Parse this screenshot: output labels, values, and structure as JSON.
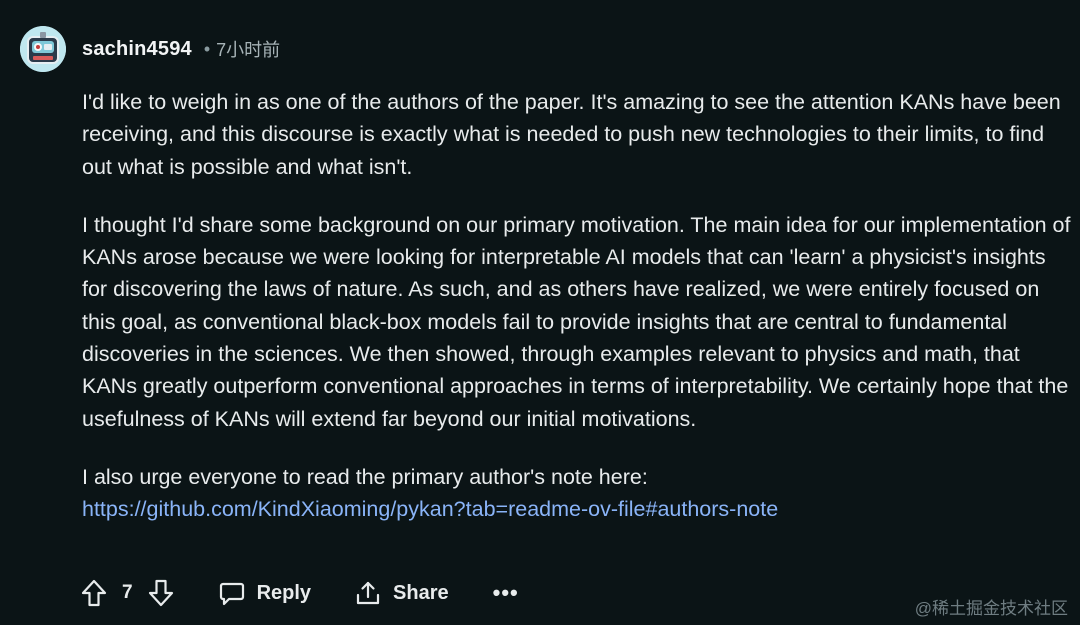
{
  "comment": {
    "username": "sachin4594",
    "dot": "•",
    "timestamp": "7小时前",
    "paragraphs": [
      "I'd like to weigh in as one of the authors of the paper. It's amazing to see the attention KANs have been receiving, and this discourse is exactly what is needed to push new technologies to their limits, to find out what is possible and what isn't.",
      "I thought I'd share some background on our primary motivation. The main idea for our implementation of KANs arose because we were looking for interpretable AI models that can 'learn' a physicist's insights for discovering the laws of nature. As such, and as others have realized, we were entirely focused on this goal, as conventional black-box models fail to provide insights that are central to fundamental discoveries in the sciences. We then showed, through examples relevant to physics and math, that KANs greatly outperform conventional approaches in terms of interpretability. We certainly hope that the usefulness of KANs will extend far beyond our initial motivations.",
      "I also urge everyone to read the primary author's note here:"
    ],
    "link": "https://github.com/KindXiaoming/pykan?tab=readme-ov-file#authors-note"
  },
  "actions": {
    "upvote_icon": "arrow-up-icon",
    "vote_count": "7",
    "downvote_icon": "arrow-down-icon",
    "reply_icon": "speech-bubble-icon",
    "reply_label": "Reply",
    "share_icon": "share-icon",
    "share_label": "Share",
    "more_label": "•••"
  },
  "watermark": "@稀土掘金技术社区",
  "colors": {
    "background": "#0b1416",
    "text": "#e8ebec",
    "link": "#8ab4f8",
    "muted": "#a7b3b7"
  }
}
